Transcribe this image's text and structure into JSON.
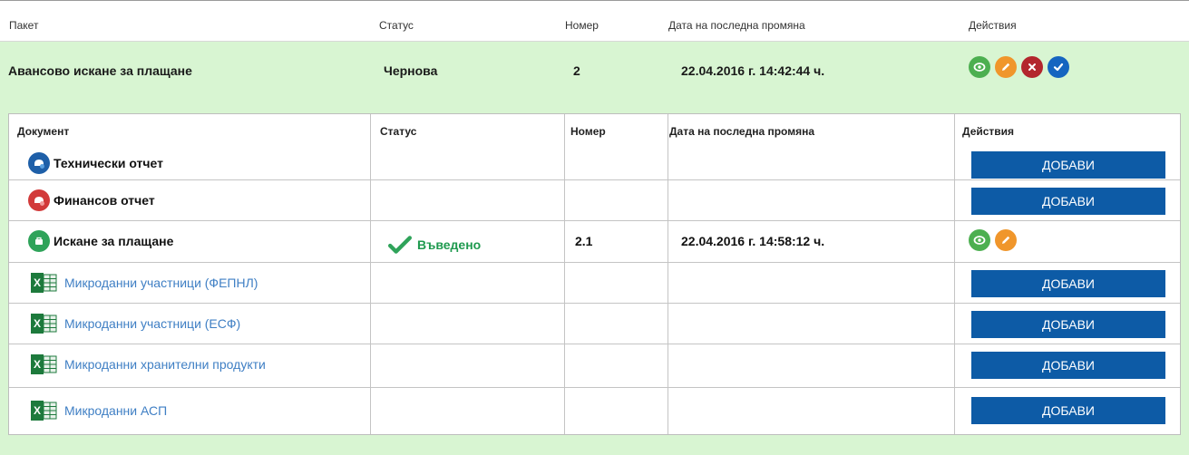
{
  "outer_header": {
    "package": "Пакет",
    "status": "Статус",
    "number": "Номер",
    "last_modified": "Дата на последна промяна",
    "actions": "Действия"
  },
  "package": {
    "name": "Авансово искане за плащане",
    "status": "Чернова",
    "number": "2",
    "last_modified": "22.04.2016 г. 14:42:44 ч.",
    "actions": [
      "view-icon",
      "edit-icon",
      "delete-icon",
      "confirm-icon"
    ]
  },
  "inner_header": {
    "document": "Документ",
    "status": "Статус",
    "number": "Номер",
    "last_modified": "Дата на последна промяна",
    "actions": "Действия"
  },
  "documents": [
    {
      "name": "Технически отчет",
      "icon": "technical-report-icon",
      "icon_color": "#1e5fa8",
      "add_label": "ДОБАВИ"
    },
    {
      "name": "Финансов отчет",
      "icon": "financial-report-icon",
      "icon_color": "#d23a3a",
      "add_label": "ДОБАВИ"
    },
    {
      "name": "Искане за плащане",
      "icon": "payment-request-icon",
      "icon_color": "#2fa35a",
      "status": "Въведено",
      "number": "2.1",
      "last_modified": "22.04.2016 г. 14:58:12 ч."
    },
    {
      "name": "Микроданни участници (ФЕПНЛ)",
      "icon": "excel-icon",
      "add_label": "ДОБАВИ"
    },
    {
      "name": "Микроданни участници (ЕСФ)",
      "icon": "excel-icon",
      "add_label": "ДОБАВИ"
    },
    {
      "name": "Микроданни хранителни продукти",
      "icon": "excel-icon",
      "add_label": "ДОБАВИ"
    },
    {
      "name": "Микроданни АСП",
      "icon": "excel-icon",
      "add_label": "ДОБАВИ"
    }
  ],
  "colors": {
    "package_row_bg": "#d8f5d2",
    "add_button": "#0d5ba6",
    "view": "#4caf50",
    "edit": "#f0962b",
    "delete": "#b3262d",
    "confirm": "#1565c0",
    "status_ok": "#1f9a4f",
    "link": "#3f7fc4"
  }
}
